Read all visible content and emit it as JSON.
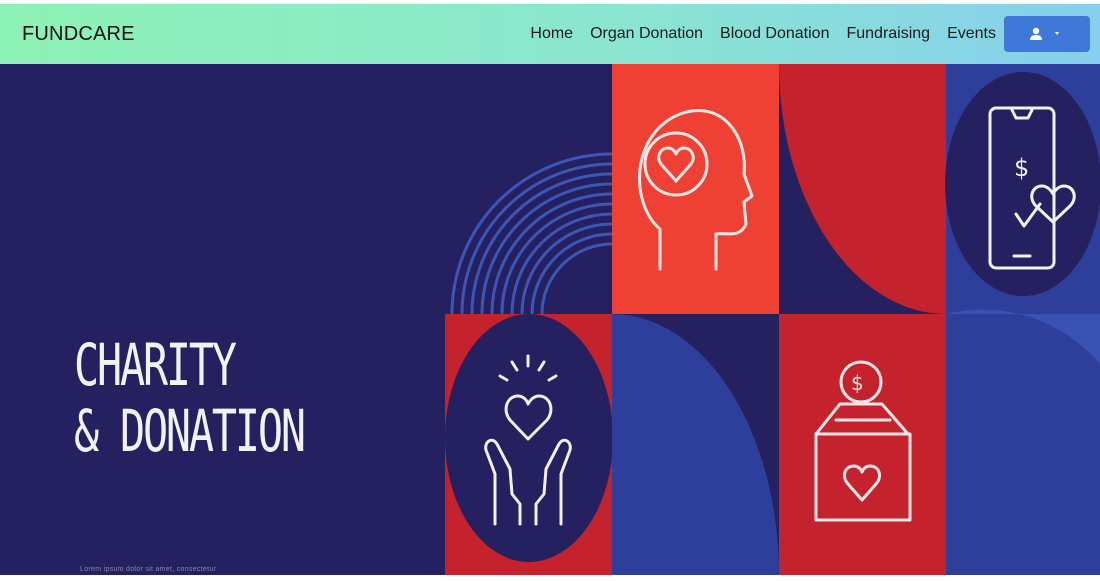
{
  "navbar": {
    "brand": "FUNDCARE",
    "links": [
      "Home",
      "Organ Donation",
      "Blood Donation",
      "Fundraising",
      "Events"
    ],
    "user_button_icon": "user-icon",
    "dropdown_icon": "caret-down-icon"
  },
  "hero": {
    "title_line1": "CHARITY",
    "title_line2": "& DONATION",
    "small_text": "Lorem ipsum dolor sit amet, consectetur",
    "icons": [
      "head-heart-icon",
      "phone-dollar-heart-icon",
      "hands-heart-icon",
      "donation-box-icon"
    ]
  },
  "colors": {
    "navbar_gradient": [
      "#8df2b5",
      "#86cfee"
    ],
    "button": "#3f78d8",
    "hero_navy": "#25205f",
    "accent_red": "#c4232e",
    "accent_orange_red": "#ee4134",
    "accent_blue": "#2d3e9b"
  }
}
